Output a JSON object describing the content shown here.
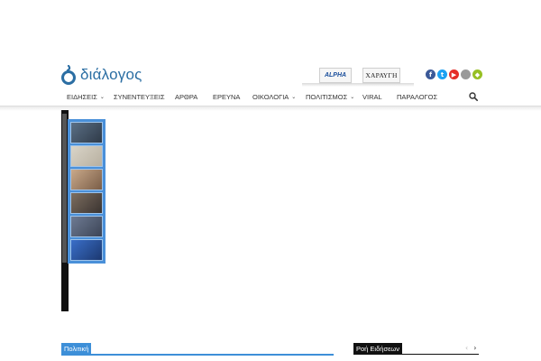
{
  "logo": {
    "text": "διάλογος",
    "mark_color": "#2b6ea3"
  },
  "partners": [
    {
      "name": "alpha-logo",
      "label": "ALPHA"
    },
    {
      "name": "xaraugi-logo",
      "label": "ΧΑΡΑΥΓΗ"
    }
  ],
  "social": [
    {
      "icon": "facebook-icon",
      "glyph": "f",
      "color": "#3b5998"
    },
    {
      "icon": "twitter-icon",
      "glyph": "t",
      "color": "#1da1f2"
    },
    {
      "icon": "youtube-icon",
      "glyph": "▶",
      "color": "#e52d27"
    },
    {
      "icon": "apple-icon",
      "glyph": "",
      "color": "#999999"
    },
    {
      "icon": "android-icon",
      "glyph": "◆",
      "color": "#97c024"
    }
  ],
  "nav": {
    "items": [
      {
        "label": "ΕΙΔΗΣΕΙΣ",
        "dropdown": true
      },
      {
        "label": "ΣΥΝΕΝΤΕΥΞΕΙΣ",
        "dropdown": false
      },
      {
        "label": "ΑΡΘΡΑ",
        "dropdown": false
      },
      {
        "label": "ΕΡΕΥΝΑ",
        "dropdown": false
      },
      {
        "label": "ΟΙΚΟΛΟΓΙΑ",
        "dropdown": true
      },
      {
        "label": "ΠΟΛΙΤΙΣΜΟΣ",
        "dropdown": true
      },
      {
        "label": "VIRAL",
        "dropdown": false
      },
      {
        "label": "ΠΑΡΑΛΟΓΟΣ",
        "dropdown": false
      }
    ],
    "chevron": "⌄",
    "search_icon": "search-icon"
  },
  "slider": {
    "thumbnails": [
      {
        "name": "thumb-man-suit",
        "colors": [
          "#5a6f85",
          "#2f3a48"
        ]
      },
      {
        "name": "thumb-document",
        "colors": [
          "#d9d4c8",
          "#b8b0a0"
        ]
      },
      {
        "name": "thumb-man-portrait",
        "colors": [
          "#c9a98a",
          "#7a5d47"
        ]
      },
      {
        "name": "thumb-meeting",
        "colors": [
          "#7d6e60",
          "#3a3330"
        ]
      },
      {
        "name": "thumb-group",
        "colors": [
          "#6e7b93",
          "#3c4456"
        ]
      },
      {
        "name": "thumb-car",
        "colors": [
          "#3a6fc9",
          "#1c3870"
        ]
      }
    ]
  },
  "sections": {
    "politiki": "Πολιτική",
    "roi": "Ροή Ειδήσεων",
    "prev": "‹",
    "next": "›"
  }
}
